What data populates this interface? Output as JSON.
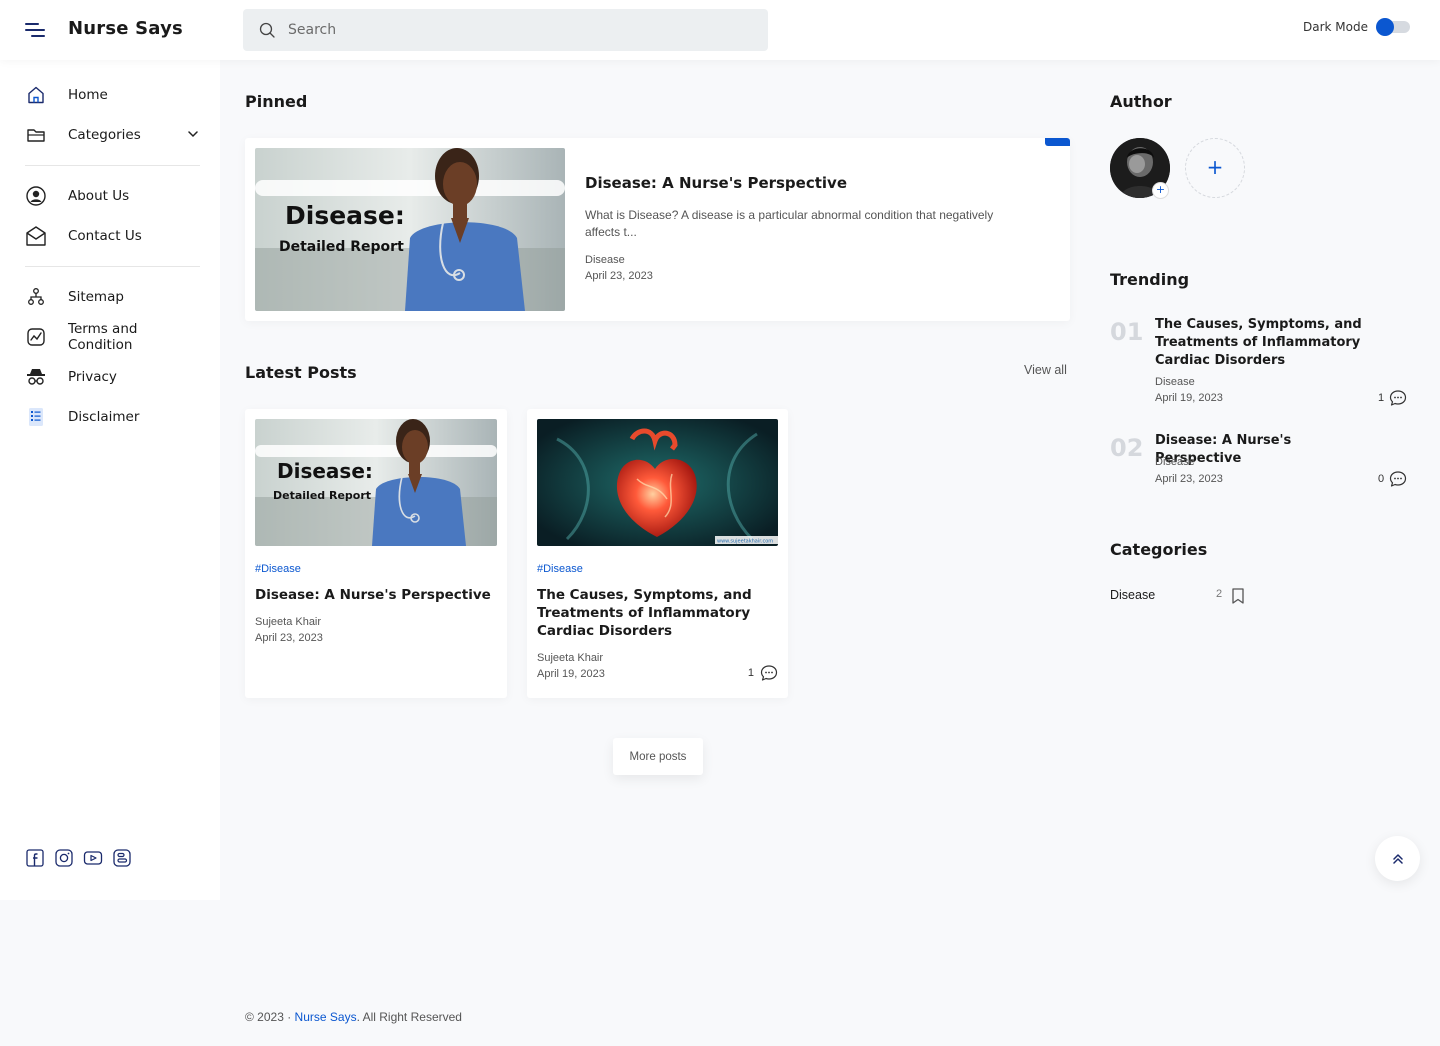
{
  "header": {
    "brand": "Nurse Says",
    "search_placeholder": "Search",
    "dark_mode_label": "Dark Mode",
    "dark_mode_on": false,
    "accent": "#0b57d0"
  },
  "sidebar": {
    "items": [
      {
        "label": "Home",
        "icon": "home-icon"
      },
      {
        "label": "Categories",
        "icon": "folder-icon"
      },
      {
        "label": "About Us",
        "icon": "user-circle-icon"
      },
      {
        "label": "Contact Us",
        "icon": "envelope-icon"
      },
      {
        "label": "Sitemap",
        "icon": "sitemap-icon"
      },
      {
        "label": "Terms and Condition",
        "icon": "chart-icon"
      },
      {
        "label": "Privacy",
        "icon": "spy-icon"
      },
      {
        "label": "Disclaimer",
        "icon": "list-icon"
      }
    ],
    "socials": [
      "facebook-icon",
      "instagram-icon",
      "youtube-icon",
      "blogger-icon"
    ]
  },
  "main": {
    "pinned_title": "Pinned",
    "pinned": {
      "thumb_line1": "Disease:",
      "thumb_line2": "Detailed Report",
      "title": "Disease: A Nurse's Perspective",
      "excerpt": "What is Disease? A disease is a particular abnormal condition that negatively affects t...",
      "category": "Disease",
      "date": "April 23, 2023"
    },
    "latest_title": "Latest Posts",
    "view_all": "View all",
    "posts": [
      {
        "thumb_line1": "Disease:",
        "thumb_line2": "Detailed Report",
        "tag": "#Disease",
        "title": "Disease: A Nurse's Perspective",
        "author": "Sujeeta Khair",
        "date": "April 23, 2023"
      },
      {
        "thumb_watermark": "www.sujeetakhair.com",
        "tag": "#Disease",
        "title": "The Causes, Symptoms, and Treatments of Inflammatory Cardiac Disorders",
        "author": "Sujeeta Khair",
        "date": "April 19, 2023",
        "comments": "1"
      }
    ],
    "more_posts": "More posts"
  },
  "aside": {
    "author_title": "Author",
    "author_add_symbol": "+",
    "add_symbol": "+",
    "trending_title": "Trending",
    "trending": [
      {
        "num": "01",
        "title": "The Causes, Symptoms, and Treatments of Inflammatory Cardiac Disorders",
        "category": "Disease",
        "date": "April 19, 2023",
        "comments": "1"
      },
      {
        "num": "02",
        "title": "Disease: A Nurse's Perspective",
        "category": "Disease",
        "date": "April 23, 2023",
        "comments": "0"
      }
    ],
    "categories_title": "Categories",
    "categories": [
      {
        "name": "Disease",
        "count": "2"
      }
    ]
  },
  "footer": {
    "prefix": "© 2023 · ",
    "site": "Nurse Says",
    "suffix": ". All Right Reserved"
  }
}
